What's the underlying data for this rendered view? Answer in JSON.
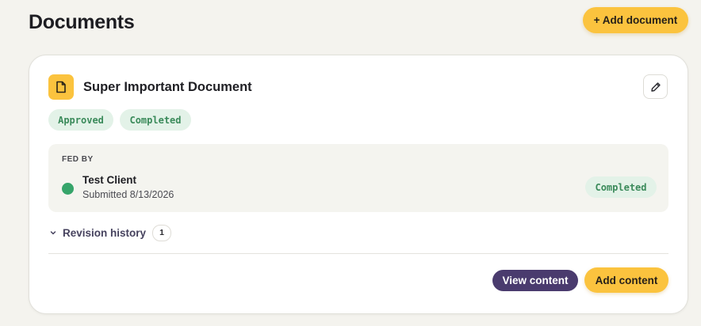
{
  "page": {
    "title": "Documents",
    "add_document_label": "+ Add document"
  },
  "document": {
    "title": "Super Important Document",
    "icon": "document-icon",
    "badges": [
      "Approved",
      "Completed"
    ],
    "fed_by": {
      "label": "FED BY",
      "client_name": "Test Client",
      "submitted": "Submitted 8/13/2026",
      "status": "Completed",
      "status_color": "#36a46a"
    },
    "revision_history": {
      "label": "Revision history",
      "count": "1"
    },
    "actions": {
      "view_label": "View content",
      "add_label": "Add content"
    }
  },
  "colors": {
    "accent": "#fbc33e",
    "primary_dark": "#4a3b6e",
    "badge_bg": "#e3f2e8",
    "badge_text": "#3a8a5a",
    "background": "#f4f3ee"
  }
}
